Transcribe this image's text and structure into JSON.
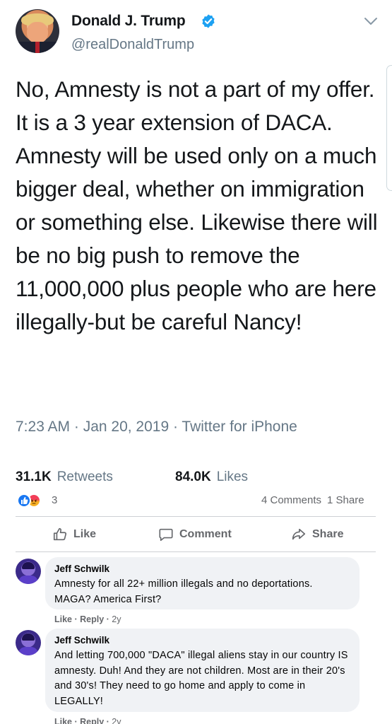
{
  "tweet": {
    "display_name": "Donald J. Trump",
    "verified_icon": "verified-badge-icon",
    "handle": "@realDonaldTrump",
    "text": "No, Amnesty is not a part of my offer. It is a 3 year extension of DACA. Amnesty will be used only on a much bigger deal, whether on immigration or something else. Likewise there will be no big push to remove the 11,000,000 plus people who are here illegally-but be careful Nancy!",
    "meta": "7:23 AM · Jan 20, 2019 · Twitter for iPhone",
    "retweets_count": "31.1K",
    "retweets_label": "Retweets",
    "likes_count": "84.0K",
    "likes_label": "Likes",
    "colors": {
      "verified": "#1da1f2",
      "text": "#14171a",
      "secondary": "#657786"
    }
  },
  "facebook": {
    "reaction_count": "3",
    "comments_label": "4 Comments",
    "shares_label": "1 Share",
    "actions": {
      "like": "Like",
      "comment": "Comment",
      "share": "Share"
    },
    "comments": [
      {
        "author": "Jeff Schwilk",
        "text": "Amnesty for all 22+ million illegals and no deportations. MAGA? America First?",
        "like": "Like",
        "reply": "Reply",
        "age": "2y"
      },
      {
        "author": "Jeff Schwilk",
        "text": "And letting 700,000 \"DACA\" illegal aliens stay in our country IS amnesty. Duh! And they are not children. Most are in their 20's and 30's! They need to go home and apply to come in LEGALLY!",
        "like": "Like",
        "reply": "Reply",
        "age": "2y"
      }
    ],
    "colors": {
      "like_blue": "#1877f2",
      "secondary": "#65676b",
      "bubble": "#f0f2f5"
    }
  }
}
